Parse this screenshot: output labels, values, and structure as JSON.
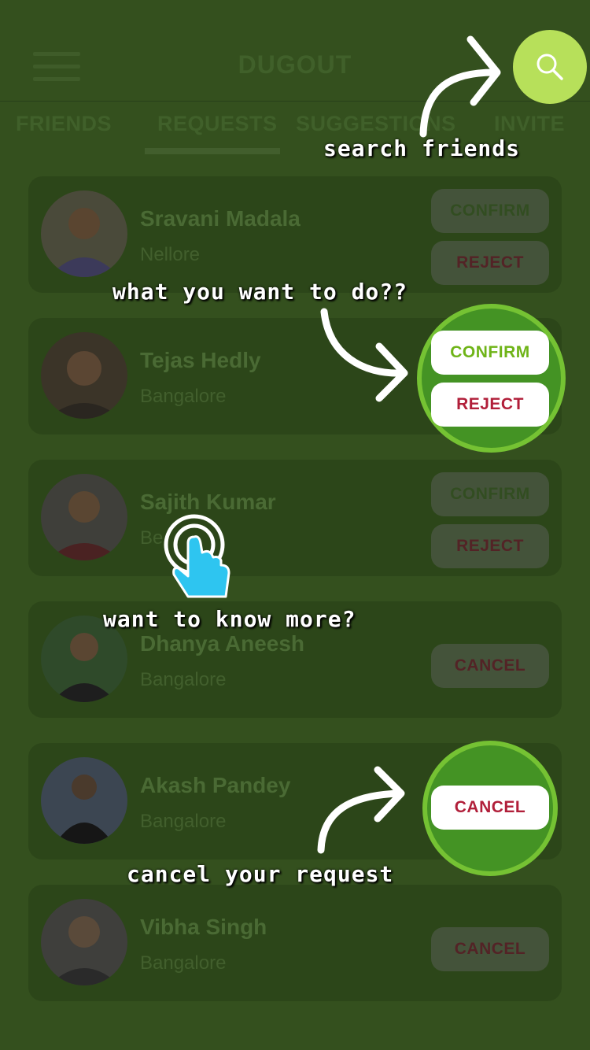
{
  "header": {
    "title": "DUGOUT"
  },
  "tabs": [
    "FRIENDS",
    "REQUESTS",
    "SUGGESTIONS",
    "INVITE"
  ],
  "active_tab": "REQUESTS",
  "requests": [
    {
      "name": "Sravani Madala",
      "city": "Nellore",
      "actions": [
        "CONFIRM",
        "REJECT"
      ]
    },
    {
      "name": "Tejas Hedly",
      "city": "Bangalore",
      "actions": [
        "CONFIRM",
        "REJECT"
      ]
    },
    {
      "name": "Sajith Kumar",
      "city": "Be",
      "actions": [
        "CONFIRM",
        "REJECT"
      ]
    },
    {
      "name": "Dhanya Aneesh",
      "city": "Bangalore",
      "actions": [
        "CANCEL"
      ]
    },
    {
      "name": "Akash Pandey",
      "city": "Bangalore",
      "actions": [
        "CANCEL"
      ]
    },
    {
      "name": "Vibha Singh",
      "city": "Bangalore",
      "actions": [
        "CANCEL"
      ]
    }
  ],
  "annotations": {
    "search": "search friends",
    "actions": "what you want to do??",
    "more": "want to know more?",
    "cancel": "cancel your request"
  },
  "colors": {
    "overlay_bg": "#34501e",
    "accent_green": "#b7e05a",
    "confirm_text": "#6fb418",
    "reject_text": "#b11f3a"
  }
}
